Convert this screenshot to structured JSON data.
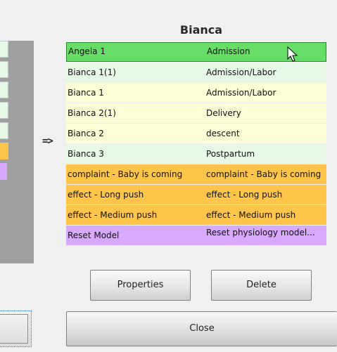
{
  "header": {
    "title": "Bianca"
  },
  "arrow": "=>",
  "mapping": [
    {
      "left": "Angela 1",
      "right": "Admission",
      "style": "selected"
    },
    {
      "left": "Bianca 1(1)",
      "right": "Admission/Labor",
      "style": "mint"
    },
    {
      "left": "Bianca 1",
      "right": "Admission/Labor",
      "style": "yellow"
    },
    {
      "left": "Bianca 2(1)",
      "right": "Delivery",
      "style": "yellow"
    },
    {
      "left": "Bianca 2",
      "right": "descent",
      "style": "yellow"
    },
    {
      "left": "Bianca 3",
      "right": "Postpartum",
      "style": "mint"
    },
    {
      "left": "complaint - Baby is coming",
      "right": "complaint - Baby is coming",
      "style": "orange"
    },
    {
      "left": "effect - Long push",
      "right": "effect - Long push",
      "style": "orange"
    },
    {
      "left": "effect - Medium push",
      "right": "effect - Medium push",
      "style": "orange"
    },
    {
      "left": "Reset Model",
      "right": "Reset physiology model...",
      "style": "purple"
    }
  ],
  "buttons": {
    "properties": "Properties",
    "delete": "Delete",
    "close": "Close"
  },
  "colors": {
    "selected": "#66dd66",
    "mint": "#e6f8e6",
    "yellow": "#fdfdd6",
    "orange": "#ffc54a",
    "purple": "#d9a8ff"
  }
}
